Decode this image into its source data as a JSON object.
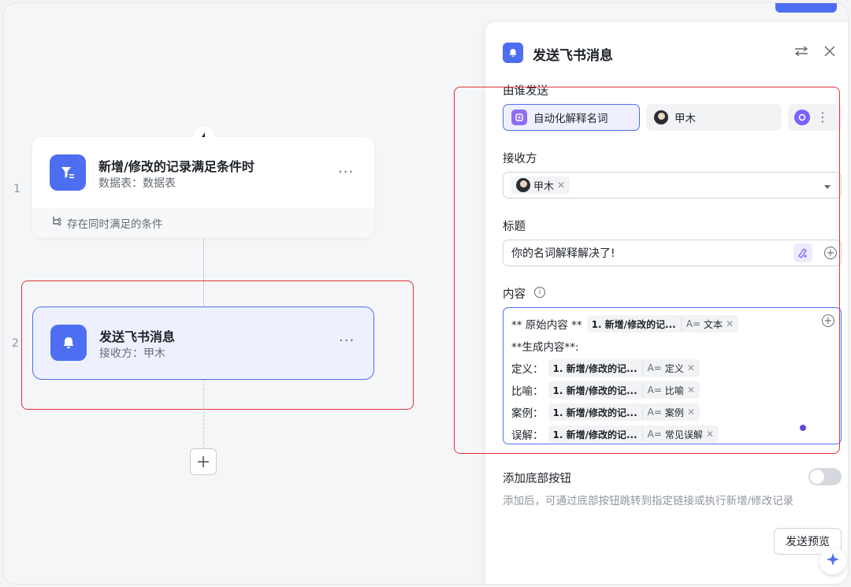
{
  "canvas": {
    "steps": [
      {
        "number": "1"
      },
      {
        "number": "2"
      }
    ],
    "trigger": {
      "title": "新增/修改的记录满足条件时",
      "subtitle": "数据表：数据表",
      "footer": "存在同时满足的条件",
      "more": "···"
    },
    "action": {
      "title": "发送飞书消息",
      "subtitle": "接收方：甲木",
      "more": "···"
    },
    "add_label": "+"
  },
  "panel": {
    "title": "发送飞书消息",
    "sender_label": "由谁发送",
    "sender_options": [
      "自动化解释名词",
      "甲木"
    ],
    "recipient_label": "接收方",
    "recipient_tag": "甲木",
    "title_label": "标题",
    "title_value": "你的名词解释解决了!",
    "content_label": "内容",
    "content": {
      "line1_prefix": "** 原始内容 **",
      "ref_source": "1. 新增/修改的记...",
      "line1_field": "文本",
      "line2": "**生成内容**:",
      "rows": [
        {
          "label": "定义：",
          "field": "定义"
        },
        {
          "label": "比喻：",
          "field": "比喻"
        },
        {
          "label": "案例：",
          "field": "案例"
        },
        {
          "label": "误解：",
          "field": "常见误解"
        }
      ],
      "field_prefix": "A="
    },
    "bottom_button_label": "添加底部按钮",
    "bottom_button_hint": "添加后，可通过底部按钮跳转到指定链接或执行新增/修改记录",
    "preview_button": "发送预览"
  },
  "colors": {
    "accent": "#4e6ef2",
    "highlight_box": "#e5303a",
    "ai_purple": "#7b61ff"
  }
}
